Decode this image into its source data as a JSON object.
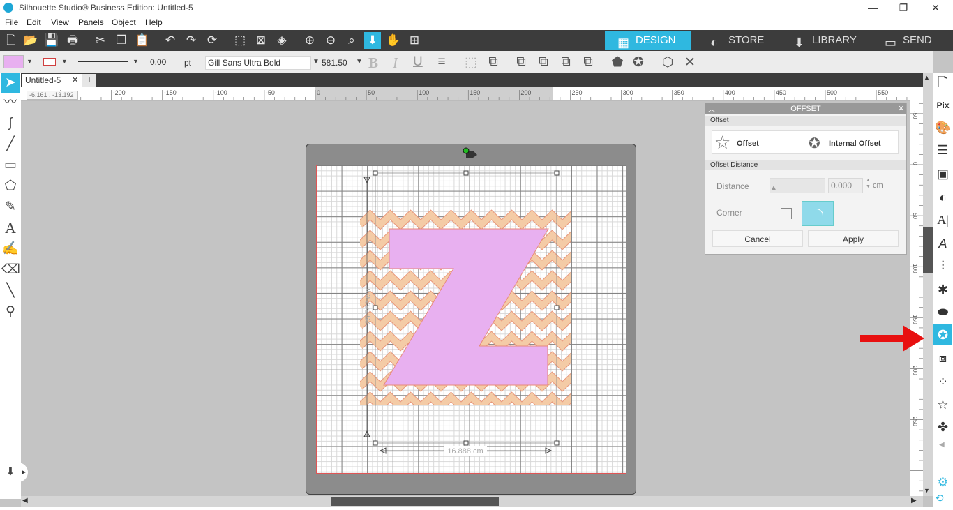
{
  "window": {
    "title": "Silhouette Studio® Business Edition: Untitled-5",
    "minimize": "—",
    "restore": "❐",
    "close": "✕"
  },
  "menu": [
    "File",
    "Edit",
    "View",
    "Panels",
    "Object",
    "Help"
  ],
  "nav_tabs": {
    "design": "DESIGN",
    "store": "STORE",
    "library": "LIBRARY",
    "send": "SEND"
  },
  "props": {
    "line_width": "0.00",
    "line_unit": "pt",
    "font_name": "Gill Sans Ultra Bold",
    "font_size": "581.50",
    "bold": "B",
    "italic": "I",
    "underline": "U"
  },
  "document_tab": {
    "name": "Untitled-5",
    "close": "✕",
    "add": "+"
  },
  "coords": "-6.161 , -13.192",
  "ruler_h": [
    "-200",
    "-150",
    "-100",
    "-50",
    "0",
    "50",
    "100",
    "150",
    "200",
    "250",
    "300",
    "350",
    "400",
    "450",
    "500",
    "550"
  ],
  "ruler_v": [
    "-50",
    "0",
    "50",
    "100",
    "150",
    "200",
    "250"
  ],
  "design": {
    "letter": "Z",
    "width_label": "16.888 cm",
    "height_label": "25.562 cm"
  },
  "offset_panel": {
    "title": "OFFSET",
    "section_offset": "Offset",
    "offset_btn": "Offset",
    "internal_offset_btn": "Internal Offset",
    "section_distance": "Offset Distance",
    "distance_label": "Distance",
    "distance_value": "0.000",
    "distance_unit": "cm",
    "corner_label": "Corner",
    "cancel": "Cancel",
    "apply": "Apply"
  },
  "colors": {
    "accent": "#2fb8e0",
    "letter_fill": "#e8b0f0",
    "chevron": "#f4cba6",
    "arrow": "#e81010"
  }
}
